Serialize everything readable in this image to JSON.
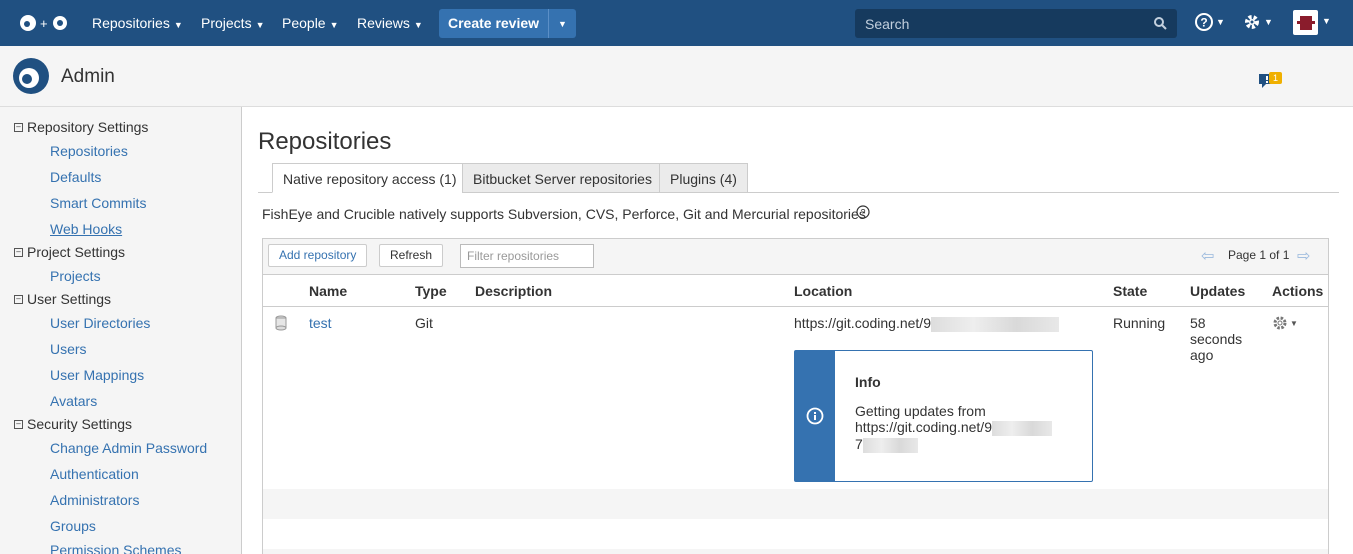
{
  "nav": {
    "items": [
      "Repositories",
      "Projects",
      "People",
      "Reviews"
    ],
    "create_review": "Create review",
    "search_placeholder": "Search"
  },
  "header": {
    "title": "Admin",
    "notification_count": "1"
  },
  "sidebar": {
    "sections": [
      {
        "label": "Repository Settings",
        "links": [
          "Repositories",
          "Defaults",
          "Smart Commits",
          "Web Hooks"
        ]
      },
      {
        "label": "Project Settings",
        "links": [
          "Projects"
        ]
      },
      {
        "label": "User Settings",
        "links": [
          "User Directories",
          "Users",
          "User Mappings",
          "Avatars"
        ]
      },
      {
        "label": "Security Settings",
        "links": [
          "Change Admin Password",
          "Authentication",
          "Administrators",
          "Groups",
          "Permission Schemes"
        ]
      }
    ]
  },
  "main": {
    "title": "Repositories",
    "tabs": [
      "Native repository access (1)",
      "Bitbucket Server repositories",
      "Plugins (4)"
    ],
    "description": "FishEye and Crucible natively supports Subversion, CVS, Perforce, Git and Mercurial repositories",
    "toolbar": {
      "add_label": "Add repository",
      "refresh_label": "Refresh",
      "filter_placeholder": "Filter repositories",
      "page_label": "Page 1 of 1"
    },
    "columns": [
      "Name",
      "Type",
      "Description",
      "Location",
      "State",
      "Updates",
      "Actions"
    ],
    "rows": [
      {
        "name": "test",
        "type": "Git",
        "description": "",
        "location": "https://git.coding.net/9",
        "state": "Running",
        "updates": "58 seconds ago"
      }
    ],
    "info": {
      "title": "Info",
      "text_line1": "Getting updates from",
      "text_line2": "https://git.coding.net/9",
      "text_line3": "7"
    }
  },
  "colors": {
    "nav_bg": "#205081",
    "accent": "#3572b0",
    "sidebar_bg": "#f5f5f5"
  }
}
